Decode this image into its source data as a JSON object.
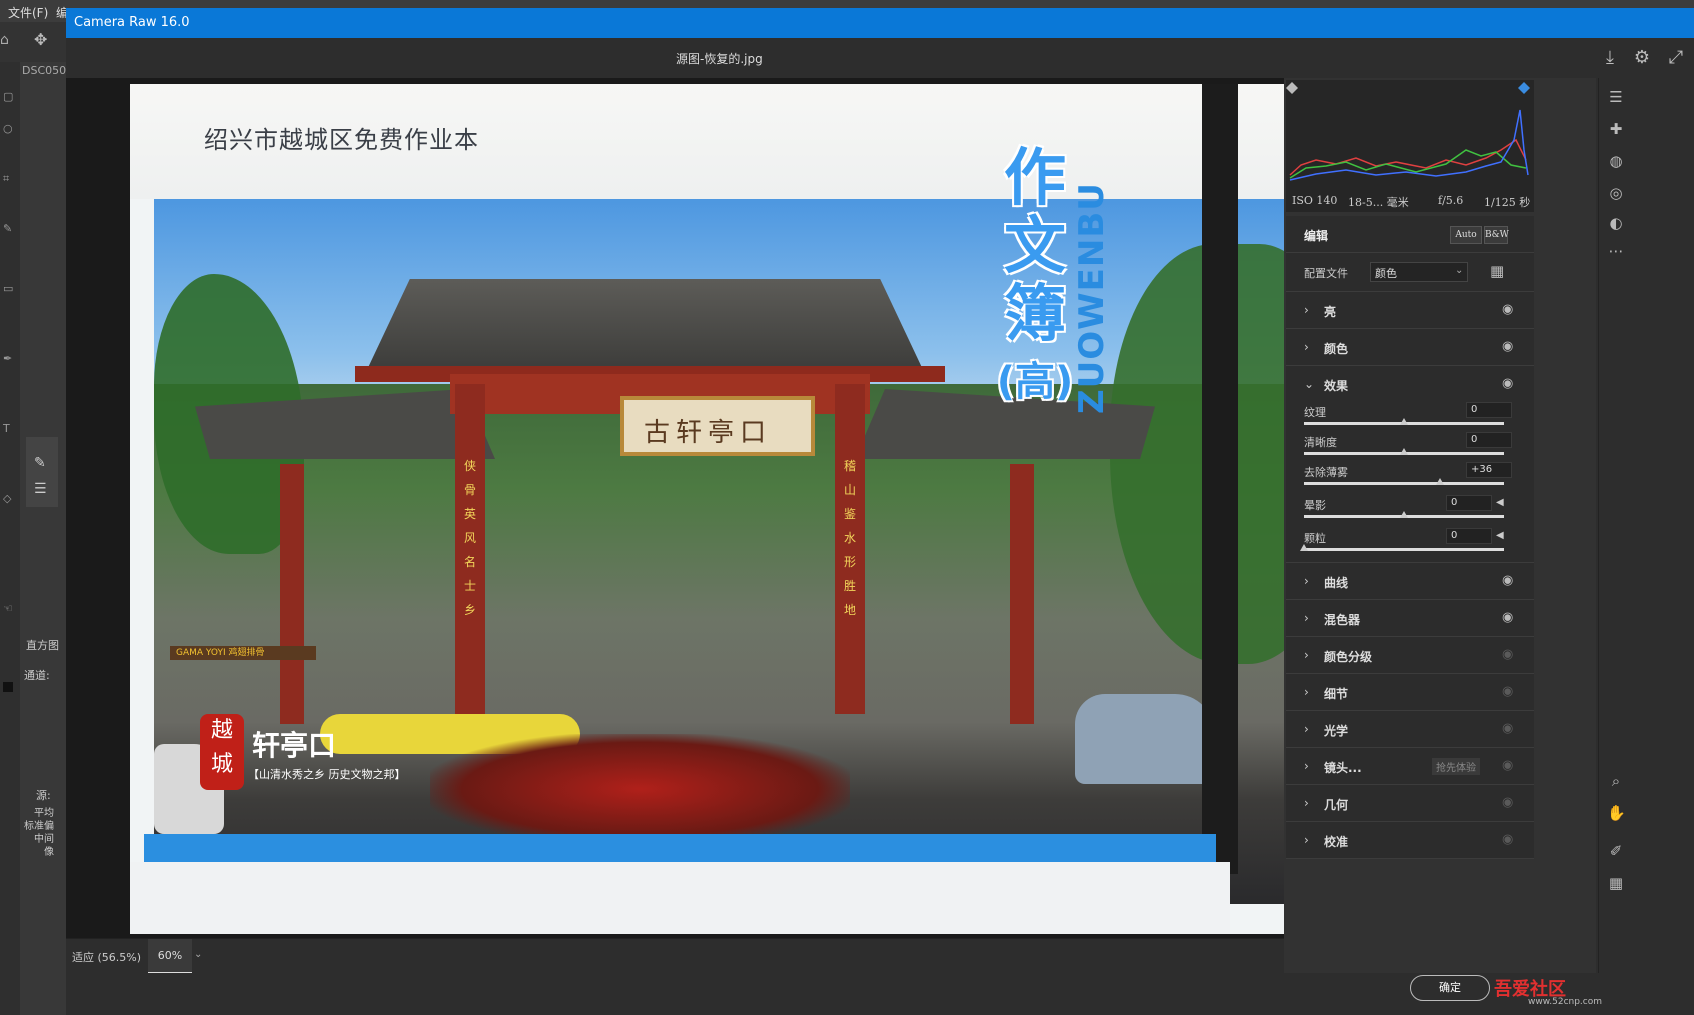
{
  "ps": {
    "menu_file": "文件(F)",
    "menu_e": "编",
    "doc_tab": "DSC050",
    "panel_histogram": "直方图",
    "panel_channel": "通道:",
    "panel_source": "源:",
    "stats": [
      "平均",
      "标准偏",
      "中间",
      "像"
    ]
  },
  "window": {
    "title": "Camera Raw 16.0",
    "filename": "源图-恢复的.jpg"
  },
  "cover": {
    "school": "绍兴市越城区免费作业本",
    "title_chars": [
      "作",
      "文",
      "簿",
      "(高)"
    ],
    "pinyin": "ZUOWENBU",
    "plaque": "古轩亭口",
    "seal_chars": [
      "越",
      "城"
    ],
    "location": "轩亭口",
    "location_sub": "【山清水秀之乡  历史文物之邦】",
    "shop_sign": "GAMA YOYI 鸡翅排骨",
    "pillar_left": "侠骨英风名士乡",
    "pillar_right": "稽山鉴水形胜地"
  },
  "bottom": {
    "fit_label": "适应 (56.5%)",
    "zoom": "60%",
    "ok_label": "确定",
    "watermark": "吾爱社区",
    "watermark_url": "www.52cnp.com"
  },
  "exif": {
    "iso": "ISO 140",
    "lens": "18-5... 毫米",
    "aperture": "f/5.6",
    "shutter": "1/125 秒"
  },
  "edit": {
    "title": "编辑",
    "auto": "Auto",
    "bw": "B&W",
    "profile_label": "配置文件",
    "profile_value": "颜色"
  },
  "sections": {
    "light": "亮",
    "color": "颜色",
    "effects": "效果",
    "curve": "曲线",
    "mixer": "混色器",
    "grading": "颜色分级",
    "detail": "细节",
    "optics": "光学",
    "lens": "镜头...",
    "lens_badge": "抢先体验",
    "geometry": "几何",
    "calibration": "校准"
  },
  "effects": {
    "texture_label": "纹理",
    "texture_value": "0",
    "clarity_label": "清晰度",
    "clarity_value": "0",
    "dehaze_label": "去除薄雾",
    "dehaze_value": "+36",
    "vignette_label": "晕影",
    "vignette_value": "0",
    "grain_label": "颗粒",
    "grain_value": "0"
  },
  "colors": {
    "titlebar": "#0a78d7",
    "panel": "#323232",
    "accent_blue": "#3a9bf0"
  }
}
